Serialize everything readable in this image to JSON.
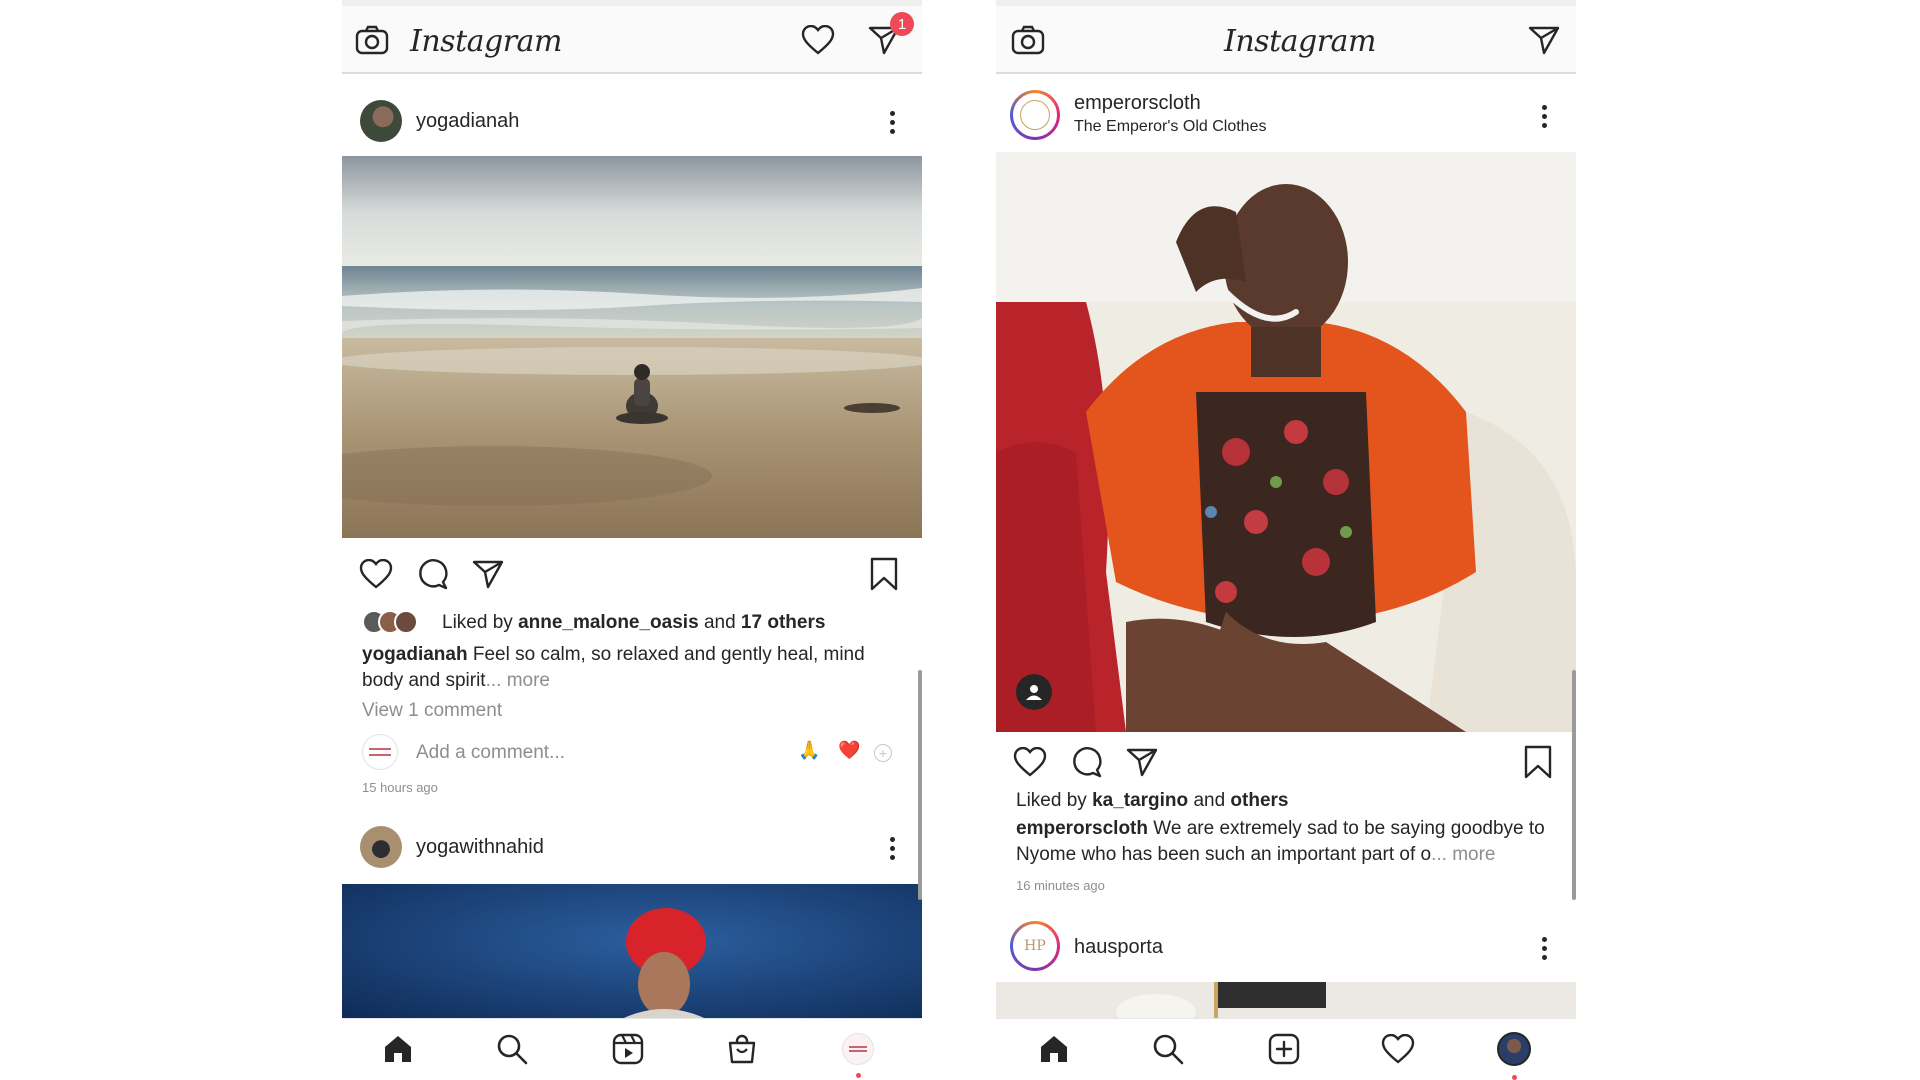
{
  "left": {
    "logo": "Instagram",
    "dm_badge_count": "1",
    "post1": {
      "username": "yogadianah",
      "likes": {
        "prefix": "Liked by",
        "user": "anne_malone_oasis",
        "and": "and",
        "others": "17 others"
      },
      "caption_user": "yogadianah",
      "caption_line1": "Feel so calm, so relaxed and gently heal, mind",
      "caption_line2": "body and spirit",
      "caption_more": "... more",
      "view_comments": "View 1 comment",
      "comment_placeholder": "Add a comment...",
      "quick_reactions": [
        "🙏",
        "❤️"
      ],
      "timestamp": "15 hours ago"
    },
    "post2": {
      "username": "yogawithnahid"
    },
    "nav": [
      "home",
      "search",
      "reels",
      "shop",
      "profile"
    ]
  },
  "right": {
    "logo": "Instagram",
    "post1": {
      "username": "emperorscloth",
      "subtitle": "The Emperor's Old Clothes",
      "likes": {
        "prefix": "Liked by",
        "user": "ka_targino",
        "and": "and",
        "others": "others"
      },
      "caption_user": "emperorscloth",
      "caption_line1": "We are extremely sad to be saying goodbye to",
      "caption_line2": "Nyome who has been such an important part of o",
      "caption_more": "... more",
      "timestamp": "16 minutes ago"
    },
    "post2": {
      "username": "hausporta",
      "avatar_text": "HP"
    },
    "nav": [
      "home",
      "search",
      "new-post",
      "activity",
      "profile"
    ]
  },
  "colors": {
    "badge": "#ed4956",
    "text": "#262626",
    "muted": "#8e8e8e",
    "reels_dot": "#ed4956"
  }
}
